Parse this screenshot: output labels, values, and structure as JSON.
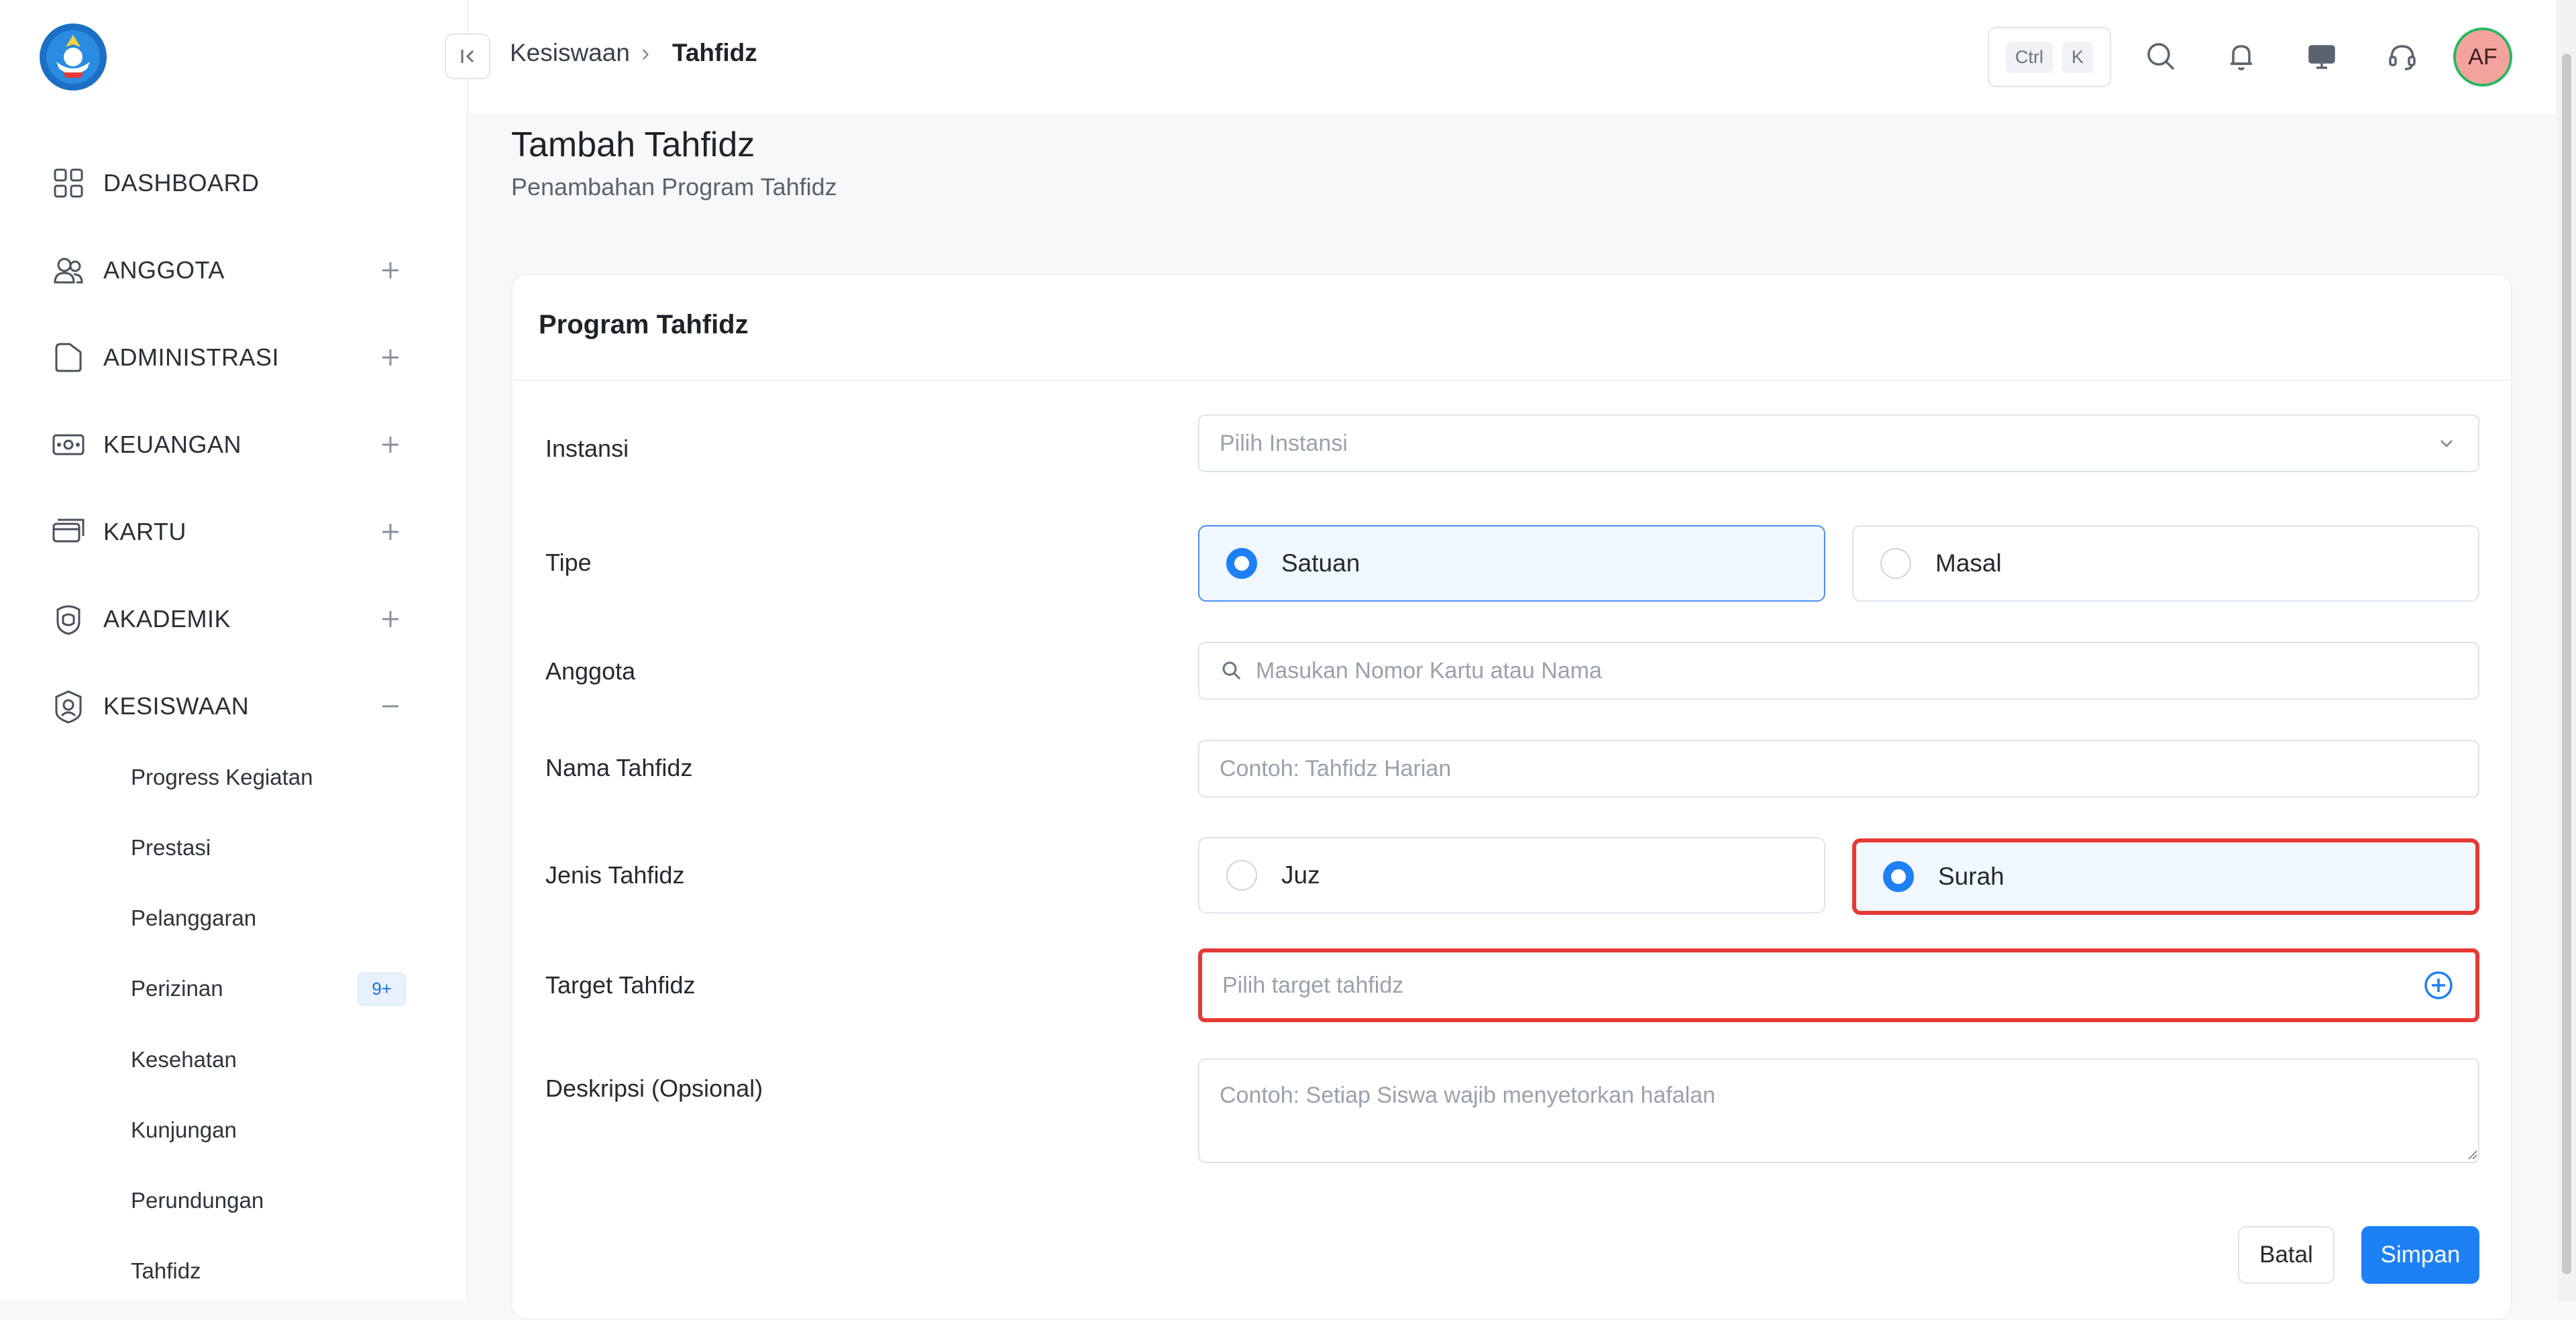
{
  "sidebar": {
    "logo_icon": "tut-wuri-handayani-logo",
    "items": [
      {
        "label": "DASHBOARD",
        "icon": "grid-icon",
        "expand": ""
      },
      {
        "label": "ANGGOTA",
        "icon": "users-icon",
        "expand": "+"
      },
      {
        "label": "ADMINISTRASI",
        "icon": "folder-icon",
        "expand": "+"
      },
      {
        "label": "KEUANGAN",
        "icon": "money-icon",
        "expand": "+"
      },
      {
        "label": "KARTU",
        "icon": "card-icon",
        "expand": "+"
      },
      {
        "label": "AKADEMIK",
        "icon": "academic-icon",
        "expand": "+"
      },
      {
        "label": "KESISWAAN",
        "icon": "student-badge-icon",
        "expand": "−"
      }
    ],
    "sub_items": [
      {
        "label": "Progress Kegiatan"
      },
      {
        "label": "Prestasi"
      },
      {
        "label": "Pelanggaran"
      },
      {
        "label": "Perizinan",
        "badge": "9+"
      },
      {
        "label": "Kesehatan"
      },
      {
        "label": "Kunjungan"
      },
      {
        "label": "Perundungan"
      },
      {
        "label": "Tahfidz"
      }
    ]
  },
  "header": {
    "breadcrumb": {
      "parent": "Kesiswaan",
      "separator": "›",
      "current": "Tahfidz"
    },
    "shortcut": {
      "key1": "Ctrl",
      "key2": "K"
    },
    "avatar_initials": "AF"
  },
  "page": {
    "title": "Tambah Tahfidz",
    "subtitle": "Penambahan Program Tahfidz"
  },
  "form": {
    "card_title": "Program Tahfidz",
    "instansi": {
      "label": "Instansi",
      "placeholder": "Pilih Instansi"
    },
    "tipe": {
      "label": "Tipe",
      "options": [
        "Satuan",
        "Masal"
      ],
      "selected": "Satuan"
    },
    "anggota": {
      "label": "Anggota",
      "placeholder": "Masukan Nomor Kartu atau Nama"
    },
    "nama": {
      "label": "Nama Tahfidz",
      "placeholder": "Contoh: Tahfidz Harian"
    },
    "jenis": {
      "label": "Jenis Tahfidz",
      "options": [
        "Juz",
        "Surah"
      ],
      "selected": "Surah"
    },
    "target": {
      "label": "Target Tahfidz",
      "placeholder": "Pilih target tahfidz"
    },
    "deskripsi": {
      "label": "Deskripsi (Opsional)",
      "placeholder": "Contoh: Setiap Siswa wajib menyetorkan hafalan"
    },
    "buttons": {
      "cancel": "Batal",
      "save": "Simpan"
    }
  },
  "colors": {
    "accent": "#1e80f5",
    "highlight": "#e53935",
    "avatar_bg": "#f3a39c",
    "avatar_ring": "#29b765"
  }
}
